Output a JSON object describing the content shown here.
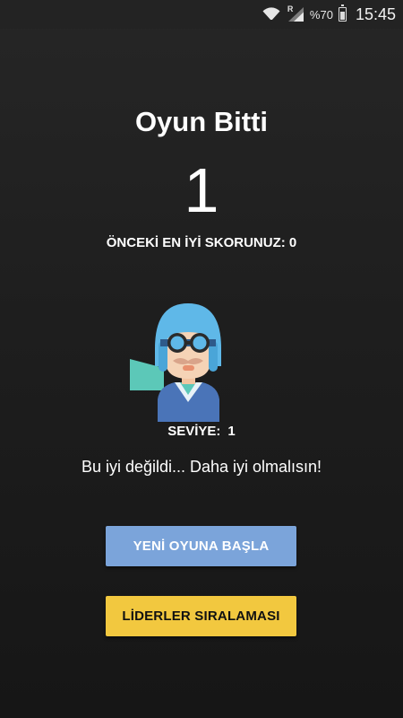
{
  "status_bar": {
    "battery_text": "%70",
    "time": "15:45",
    "roaming_label": "R",
    "icons": [
      "wifi-icon",
      "signal-icon",
      "battery-icon"
    ]
  },
  "game_over": {
    "title": "Oyun Bitti",
    "score": "1",
    "best_score_text": "ÖNCEKİ EN İYİ SKORUNUZ: 0",
    "level_label": "SEVİYE:",
    "level_value": "1",
    "message": "Bu iyi değildi... Daha iyi olmalısın!"
  },
  "buttons": {
    "new_game": "YENİ OYUNA BAŞLA",
    "leaderboard": "LİDERLER SIRALAMASI"
  },
  "colors": {
    "background": "#1e1e1e",
    "new_game_button": "#7ba4da",
    "leaderboard_button": "#f2c83f"
  },
  "avatar": {
    "icon": "pilot-avatar-icon"
  }
}
